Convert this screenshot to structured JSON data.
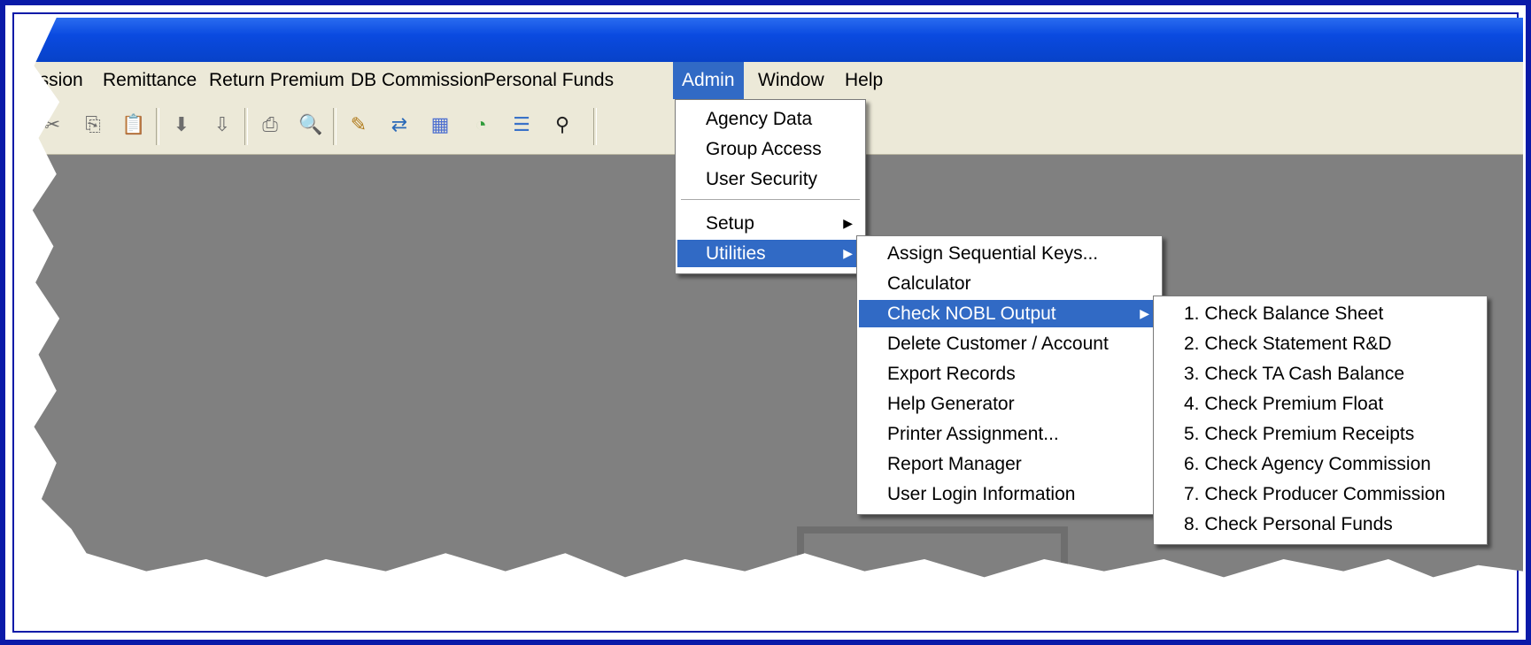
{
  "menubar": {
    "items": [
      "ission",
      "Remittance",
      "Return Premium",
      "DB Commission",
      "Personal Funds",
      "Admin",
      "Window",
      "Help"
    ],
    "active": "Admin"
  },
  "toolbar": {
    "buttons": [
      "cut-icon",
      "copy-icon",
      "paste-icon",
      "move-down-icon",
      "import-icon",
      "print-icon",
      "print-preview-icon",
      "edit-document-icon",
      "transfer-icon",
      "calculator-icon",
      "pie-chart-icon",
      "list-icon",
      "find-icon"
    ]
  },
  "admin_menu": {
    "items": [
      "Agency Data",
      "Group Access",
      "User Security",
      "Setup",
      "Utilities"
    ],
    "highlighted": "Utilities"
  },
  "utilities_menu": {
    "items": [
      "Assign Sequential Keys...",
      "Calculator",
      "Check NOBL Output",
      "Delete Customer / Account",
      "Export Records",
      "Help Generator",
      "Printer Assignment...",
      "Report Manager",
      "User Login Information"
    ],
    "highlighted": "Check NOBL Output"
  },
  "nobl_menu": {
    "items": [
      "1. Check Balance Sheet",
      "2. Check Statement R&D",
      "3. Check TA Cash Balance",
      "4. Check Premium Float",
      "5. Check Premium Receipts",
      "6. Check Agency Commission",
      "7. Check Producer Commission",
      "8. Check Personal Funds"
    ]
  },
  "colors": {
    "highlight": "#316ac5",
    "titlebar": "#0a4ae0",
    "frame": "#0a1aa8",
    "workspace": "#808080"
  }
}
